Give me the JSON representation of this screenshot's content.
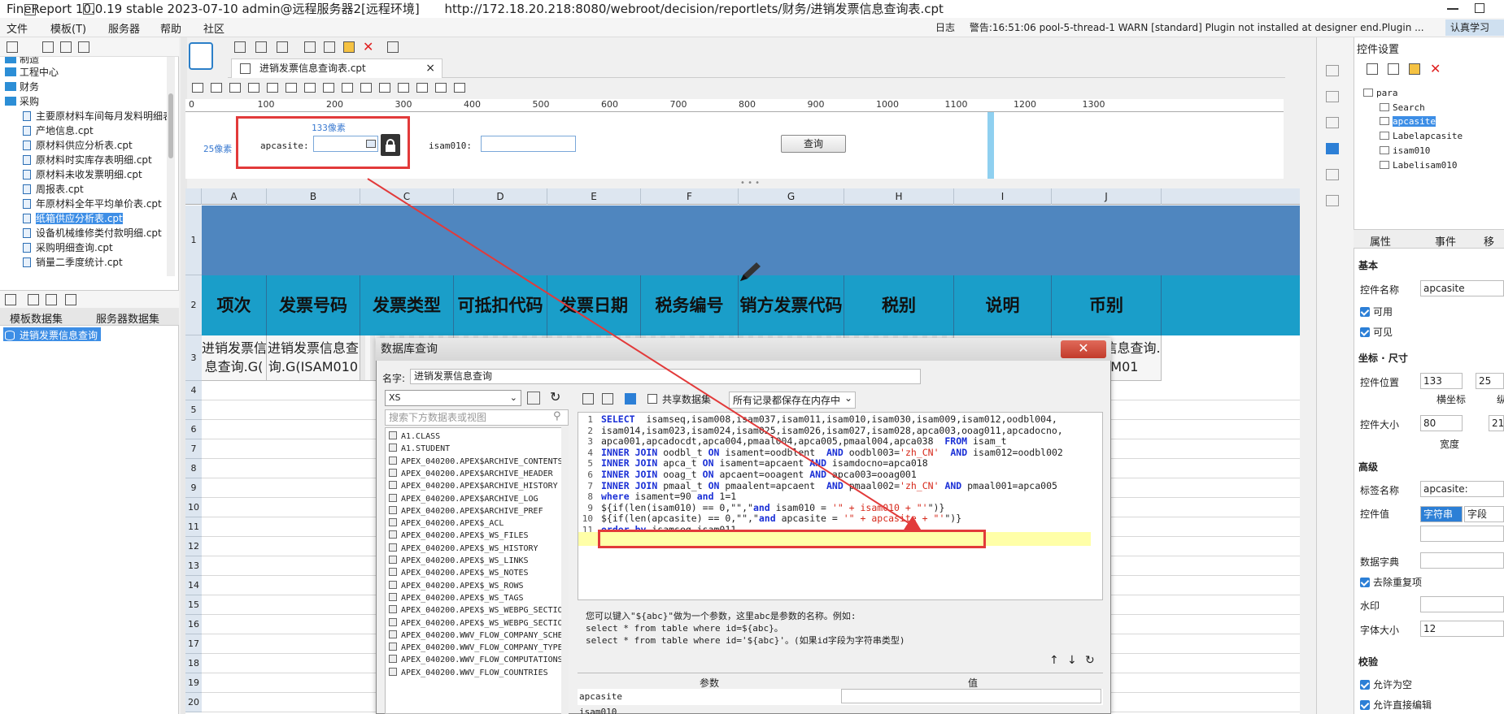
{
  "window": {
    "title": "FineReport 10.0.19 stable 2023-07-10 admin@远程服务器2[远程环境]",
    "url": "http://172.18.20.218:8080/webroot/decision/reportlets/财务/进销发票信息查询表.cpt"
  },
  "menu": [
    "文件",
    "模板(T)",
    "服务器",
    "帮助",
    "社区"
  ],
  "logbar": {
    "log_label": "日志",
    "warning": "警告:16:51:06 pool-5-thread-1 WARN [standard] Plugin not installed at designer end.Plugin ..."
  },
  "topright_btn": "认真学习",
  "tree": {
    "top_partial": "制造",
    "items": [
      {
        "type": "folder",
        "label": "工程中心"
      },
      {
        "type": "folder",
        "label": "财务"
      },
      {
        "type": "folder",
        "label": "采购"
      },
      {
        "type": "file",
        "label": "主要原材料车间每月发料明细表"
      },
      {
        "type": "file",
        "label": "产地信息.cpt"
      },
      {
        "type": "file",
        "label": "原材料供应分析表.cpt"
      },
      {
        "type": "file",
        "label": "原材料时实库存表明细.cpt"
      },
      {
        "type": "file",
        "label": "原材料未收发票明细.cpt"
      },
      {
        "type": "file",
        "label": "周报表.cpt"
      },
      {
        "type": "file",
        "label": "年原材料全年平均单价表.cpt"
      },
      {
        "type": "file",
        "label": "纸箱供应分析表.cpt",
        "selected": true
      },
      {
        "type": "file",
        "label": "设备机械维修类付款明细.cpt"
      },
      {
        "type": "file",
        "label": "采购明细查询.cpt"
      },
      {
        "type": "file",
        "label": "销量二季度统计.cpt"
      }
    ]
  },
  "dataset_tabs": [
    "模板数据集",
    "服务器数据集"
  ],
  "dataset_item": "进销发票信息查询",
  "file_tab": "进销发票信息查询表.cpt",
  "ruler": [
    "0",
    "100",
    "200",
    "300",
    "400",
    "500",
    "600",
    "700",
    "800",
    "900",
    "1000",
    "1100",
    "1200",
    "1300"
  ],
  "param": {
    "pos_hint": "133像素",
    "left_hint": "25像素",
    "apcasite_label": "apcasite:",
    "isam010_label": "isam010:",
    "query_btn": "查询"
  },
  "columns": [
    "A",
    "B",
    "C",
    "D",
    "E",
    "F",
    "G",
    "H",
    "I",
    "J"
  ],
  "rows": [
    "1",
    "2",
    "3",
    "4",
    "5",
    "6",
    "7",
    "8",
    "9",
    "10",
    "11",
    "12",
    "13",
    "14",
    "15",
    "16",
    "17",
    "18",
    "19",
    "20"
  ],
  "header_cells": [
    "项次",
    "发票号码",
    "发票类型",
    "可抵扣代码",
    "发票日期",
    "税务编号",
    "销方发票代码",
    "税别",
    "说明",
    "币别"
  ],
  "row3": {
    "A": [
      "进销发票信",
      "息查询.G(",
      "ISAM050"
    ],
    "B": [
      "进销发票信息查",
      "询.G(ISAM010"
    ],
    "I": [
      "进销发票信息查",
      "G(OODBL004)"
    ],
    "J": [
      "进销发票信息查询.",
      "G(ISAM01"
    ]
  },
  "right_panel": {
    "title": "控件设置",
    "tree": [
      "para",
      "Search",
      "apcasite",
      "Labelapcasite",
      "isam010",
      "Labelisam010"
    ],
    "tabs": [
      "属性",
      "事件",
      "移"
    ],
    "basic": "基本",
    "ctrl_name_label": "控件名称",
    "ctrl_name": "apcasite",
    "usable": "可用",
    "visible": "可见",
    "coord": "坐标 · 尺寸",
    "pos_label": "控件位置",
    "pos_x": "133",
    "pos_y": "25",
    "x_label": "横坐标",
    "y_label": "纵",
    "size_label": "控件大小",
    "width": "80",
    "height": "21",
    "w_label": "宽度",
    "advanced": "高级",
    "tag_label": "标签名称",
    "tag_value": "apcasite:",
    "ctrl_val_label": "控件值",
    "val_str": "字符串",
    "val_field": "字段",
    "dict_label": "数据字典",
    "dedup": "去除重复项",
    "watermark": "水印",
    "font_size_label": "字体大小",
    "font_size": "12",
    "validate": "校验",
    "allow_empty": "允许为空",
    "allow_edit": "允许直接编辑"
  },
  "dialog": {
    "title": "数据库查询",
    "name_label": "名字:",
    "name": "进销发票信息查询",
    "source": "XS",
    "search_placeholder": "搜索下方数据表或视图",
    "share_label": "共享数据集",
    "mem_option": "所有记录都保存在内存中",
    "tables": [
      "A1.CLASS",
      "A1.STUDENT",
      "APEX_040200.APEX$ARCHIVE_CONTENTS",
      "APEX_040200.APEX$ARCHIVE_HEADER",
      "APEX_040200.APEX$ARCHIVE_HISTORY",
      "APEX_040200.APEX$ARCHIVE_LOG",
      "APEX_040200.APEX$ARCHIVE_PREF",
      "APEX_040200.APEX$_ACL",
      "APEX_040200.APEX$_WS_FILES",
      "APEX_040200.APEX$_WS_HISTORY",
      "APEX_040200.APEX$_WS_LINKS",
      "APEX_040200.APEX$_WS_NOTES",
      "APEX_040200.APEX$_WS_ROWS",
      "APEX_040200.APEX$_WS_TAGS",
      "APEX_040200.APEX$_WS_WEBPG_SECTIO",
      "APEX_040200.APEX$_WS_WEBPG_SECTIO",
      "APEX_040200.WWV_FLOW_COMPANY_SCHE",
      "APEX_040200.WWV_FLOW_COMPANY_TYPE",
      "APEX_040200.WWV_FLOW_COMPUTATIONS",
      "APEX_040200.WWV_FLOW_COUNTRIES"
    ],
    "sql": [
      "SELECT  isamseq,isam008,isam037,isam011,isam010,isam030,isam009,isam012,oodbl004,",
      "isam014,isam023,isam024,isam025,isam026,isam027,isam028,apca003,ooag011,apcadocno,",
      "apca001,apcadocdt,apca004,pmaal004,apca005,pmaal004,apca038  FROM isam_t",
      "INNER JOIN oodbl_t ON isament=oodblent  AND oodbl003='zh_CN'  AND isam012=oodbl002",
      "INNER JOIN apca_t ON isament=apcaent AND isamdocno=apca018",
      "INNER JOIN ooag_t ON apcaent=ooagent AND apca003=ooag001",
      "INNER JOIN pmaal_t ON pmaalent=apcaent  AND pmaal002='zh_CN' AND pmaal001=apca005",
      "where isament=90 and 1=1",
      "${if(len(isam010) == 0,\"\",\"and isam010 = '\" + isam010 + \"'\")}",
      "${if(len(apcasite) == 0,\"\",\"and apcasite = '\" + apcasite + \"'\")}",
      "order by isamseq,isam011",
      ""
    ],
    "hint": [
      "您可以键入\"${abc}\"做为一个参数，这里abc是参数的名称。例如:",
      "select * from table where id=${abc}。",
      "select * from table where id='${abc}'。(如果id字段为字符串类型)"
    ],
    "param_col": "参数",
    "value_col": "值",
    "param_row": "apcasite",
    "param_row2": "isam010"
  }
}
